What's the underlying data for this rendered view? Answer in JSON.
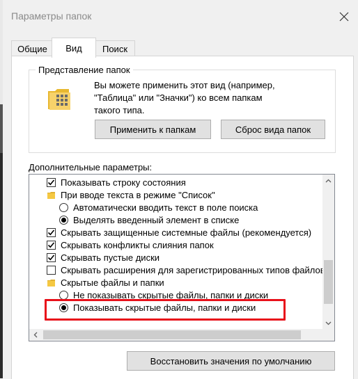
{
  "window": {
    "title": "Параметры папок"
  },
  "tabs": [
    {
      "label": "Общие"
    },
    {
      "label": "Вид"
    },
    {
      "label": "Поиск"
    }
  ],
  "folder_views": {
    "group_label": "Представление папок",
    "description_lines": [
      "Вы можете применить этот вид (например,",
      "\"Таблица\" или \"Значки\") ко всем папкам",
      "такого типа."
    ],
    "apply_button": "Применить к папкам",
    "reset_button": "Сброс вида папок"
  },
  "advanced": {
    "label": "Дополнительные параметры:",
    "items": [
      {
        "type": "checkbox",
        "checked": true,
        "label": "Показывать строку состояния"
      },
      {
        "type": "folder",
        "label": "При вводе текста в режиме \"Список\""
      },
      {
        "type": "radio",
        "checked": false,
        "label": "Автоматически вводить текст в поле поиска"
      },
      {
        "type": "radio",
        "checked": true,
        "label": "Выделять введенный элемент в списке"
      },
      {
        "type": "checkbox",
        "checked": true,
        "label": "Скрывать защищенные системные файлы (рекомендуется)"
      },
      {
        "type": "checkbox",
        "checked": true,
        "label": "Скрывать конфликты слияния папок"
      },
      {
        "type": "checkbox",
        "checked": true,
        "label": "Скрывать пустые диски"
      },
      {
        "type": "checkbox",
        "checked": false,
        "label": "Скрывать расширения для зарегистрированных типов файлов"
      },
      {
        "type": "folder",
        "label": "Скрытые файлы и папки"
      },
      {
        "type": "radio",
        "checked": false,
        "label": "Не показывать скрытые файлы, папки и диски"
      },
      {
        "type": "radio",
        "checked": true,
        "label": "Показывать скрытые файлы, папки и диски"
      }
    ]
  },
  "restore_button": "Восстановить значения по умолчанию",
  "colors": {
    "highlight": "#e8101a",
    "folder": "#f5c842"
  },
  "icons": {
    "close": "close-icon",
    "folder": "folder-icon",
    "scroll_up": "chevron-up-icon",
    "scroll_down": "chevron-down-icon"
  }
}
